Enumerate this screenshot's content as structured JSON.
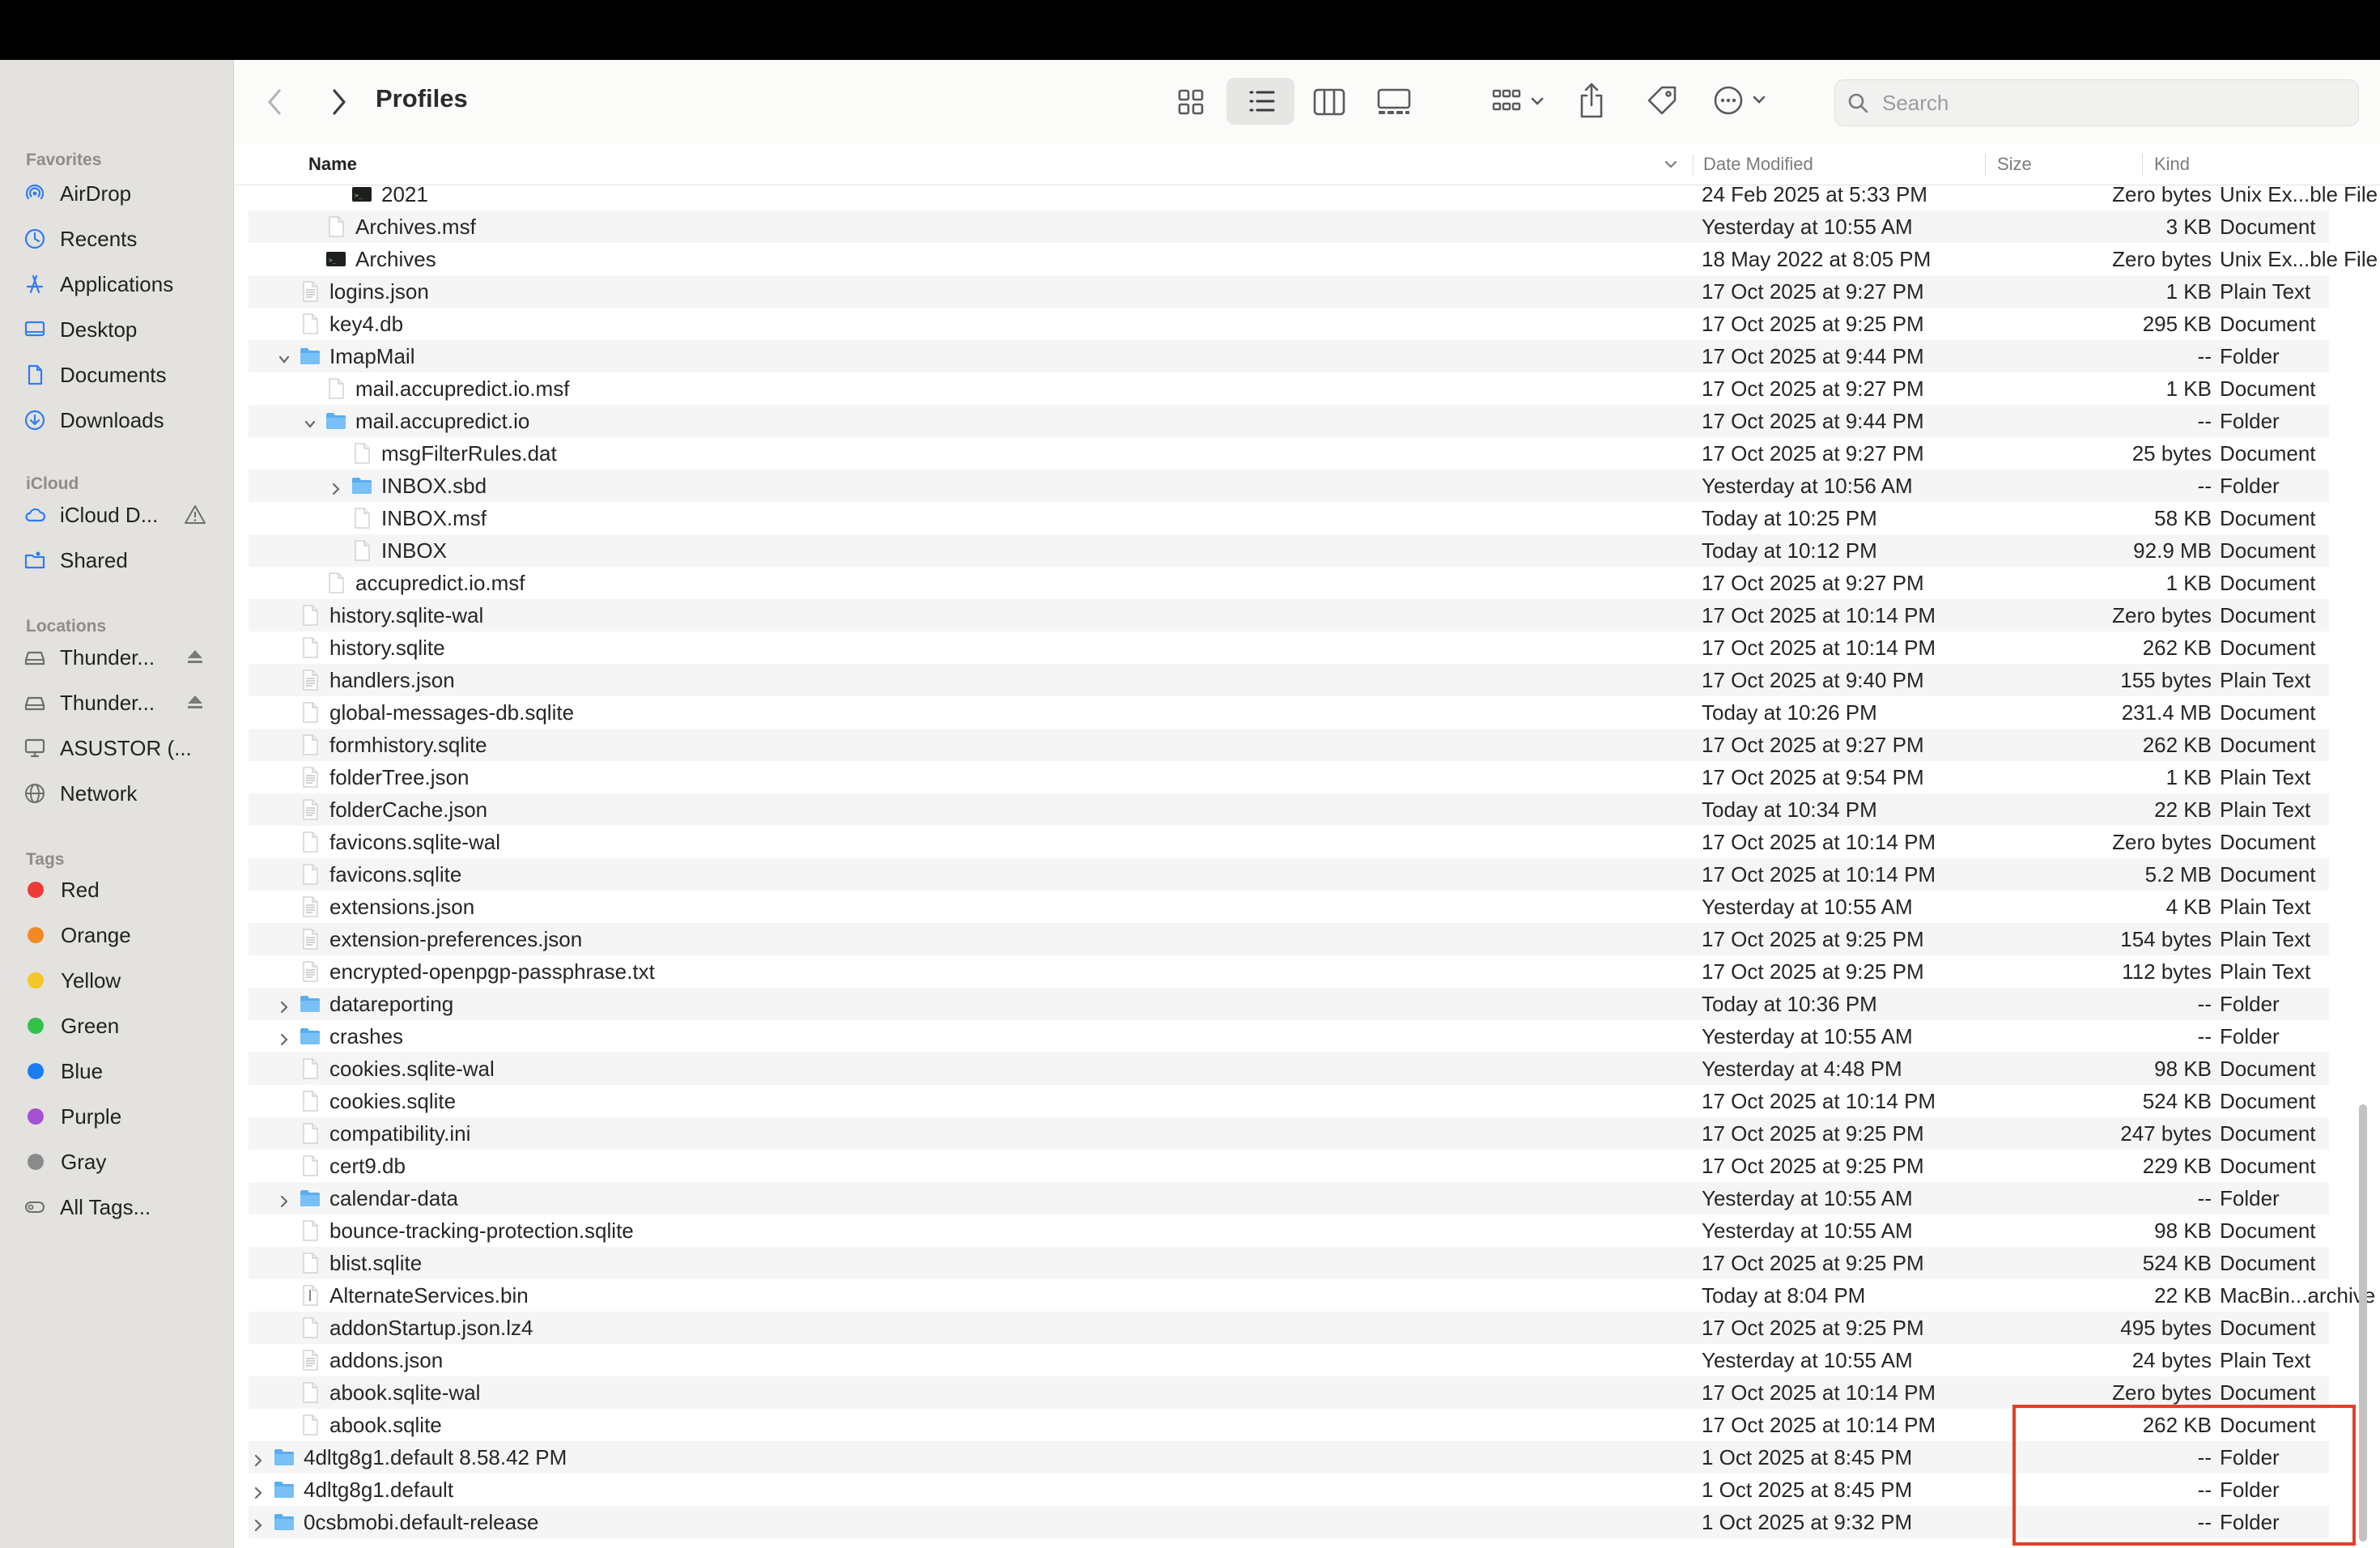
{
  "window": {
    "title": "Profiles"
  },
  "search": {
    "placeholder": "Search"
  },
  "sidebar": {
    "favorites_title": "Favorites",
    "favorites": [
      {
        "label": "AirDrop",
        "icon": "airdrop-icon"
      },
      {
        "label": "Recents",
        "icon": "clock-icon"
      },
      {
        "label": "Applications",
        "icon": "applications-icon"
      },
      {
        "label": "Desktop",
        "icon": "desktop-icon"
      },
      {
        "label": "Documents",
        "icon": "document-icon"
      },
      {
        "label": "Downloads",
        "icon": "download-icon"
      }
    ],
    "icloud_title": "iCloud",
    "icloud": [
      {
        "label": "iCloud D...",
        "icon": "cloud-icon"
      },
      {
        "label": "Shared",
        "icon": "shared-folder-icon"
      }
    ],
    "locations_title": "Locations",
    "locations": [
      {
        "label": "Thunder...",
        "icon": "drive-icon"
      },
      {
        "label": "Thunder...",
        "icon": "drive-icon"
      },
      {
        "label": "ASUSTOR (...",
        "icon": "display-icon"
      },
      {
        "label": "Network",
        "icon": "globe-icon"
      }
    ],
    "tags_title": "Tags",
    "tags": [
      {
        "label": "Red",
        "color": "#ee3b35"
      },
      {
        "label": "Orange",
        "color": "#f08a24"
      },
      {
        "label": "Yellow",
        "color": "#f5c628"
      },
      {
        "label": "Green",
        "color": "#34c14a"
      },
      {
        "label": "Blue",
        "color": "#1e7cf2"
      },
      {
        "label": "Purple",
        "color": "#a451d4"
      },
      {
        "label": "Gray",
        "color": "#8b8b8d"
      }
    ],
    "all_tags": "All Tags..."
  },
  "columns": {
    "name": "Name",
    "date": "Date Modified",
    "size": "Size",
    "kind": "Kind"
  },
  "files": [
    {
      "name": "2021",
      "date": "24 Feb 2025 at 5:33 PM",
      "size": "Zero bytes",
      "kind": "Unix Ex...ble File",
      "indent": 3,
      "type": "exec",
      "partial": true
    },
    {
      "name": "Archives.msf",
      "date": "Yesterday at 10:55 AM",
      "size": "3 KB",
      "kind": "Document",
      "indent": 2,
      "type": "doc"
    },
    {
      "name": "Archives",
      "date": "18 May 2022 at 8:05 PM",
      "size": "Zero bytes",
      "kind": "Unix Ex...ble File",
      "indent": 2,
      "type": "exec"
    },
    {
      "name": "logins.json",
      "date": "17 Oct 2025 at 9:27 PM",
      "size": "1 KB",
      "kind": "Plain Text",
      "indent": 1,
      "type": "text"
    },
    {
      "name": "key4.db",
      "date": "17 Oct 2025 at 9:25 PM",
      "size": "295 KB",
      "kind": "Document",
      "indent": 1,
      "type": "doc"
    },
    {
      "name": "ImapMail",
      "date": "17 Oct 2025 at 9:44 PM",
      "size": "--",
      "kind": "Folder",
      "indent": 1,
      "type": "folder",
      "disc": "open"
    },
    {
      "name": "mail.accupredict.io.msf",
      "date": "17 Oct 2025 at 9:27 PM",
      "size": "1 KB",
      "kind": "Document",
      "indent": 2,
      "type": "doc"
    },
    {
      "name": "mail.accupredict.io",
      "date": "17 Oct 2025 at 9:44 PM",
      "size": "--",
      "kind": "Folder",
      "indent": 2,
      "type": "folder",
      "disc": "open"
    },
    {
      "name": "msgFilterRules.dat",
      "date": "17 Oct 2025 at 9:27 PM",
      "size": "25 bytes",
      "kind": "Document",
      "indent": 3,
      "type": "doc"
    },
    {
      "name": "INBOX.sbd",
      "date": "Yesterday at 10:56 AM",
      "size": "--",
      "kind": "Folder",
      "indent": 3,
      "type": "folder",
      "disc": "closed"
    },
    {
      "name": "INBOX.msf",
      "date": "Today at 10:25 PM",
      "size": "58 KB",
      "kind": "Document",
      "indent": 3,
      "type": "doc"
    },
    {
      "name": "INBOX",
      "date": "Today at 10:12 PM",
      "size": "92.9 MB",
      "kind": "Document",
      "indent": 3,
      "type": "doc"
    },
    {
      "name": "accupredict.io.msf",
      "date": "17 Oct 2025 at 9:27 PM",
      "size": "1 KB",
      "kind": "Document",
      "indent": 2,
      "type": "doc"
    },
    {
      "name": "history.sqlite-wal",
      "date": "17 Oct 2025 at 10:14 PM",
      "size": "Zero bytes",
      "kind": "Document",
      "indent": 1,
      "type": "doc"
    },
    {
      "name": "history.sqlite",
      "date": "17 Oct 2025 at 10:14 PM",
      "size": "262 KB",
      "kind": "Document",
      "indent": 1,
      "type": "doc"
    },
    {
      "name": "handlers.json",
      "date": "17 Oct 2025 at 9:40 PM",
      "size": "155 bytes",
      "kind": "Plain Text",
      "indent": 1,
      "type": "text"
    },
    {
      "name": "global-messages-db.sqlite",
      "date": "Today at 10:26 PM",
      "size": "231.4 MB",
      "kind": "Document",
      "indent": 1,
      "type": "doc"
    },
    {
      "name": "formhistory.sqlite",
      "date": "17 Oct 2025 at 9:27 PM",
      "size": "262 KB",
      "kind": "Document",
      "indent": 1,
      "type": "doc"
    },
    {
      "name": "folderTree.json",
      "date": "17 Oct 2025 at 9:54 PM",
      "size": "1 KB",
      "kind": "Plain Text",
      "indent": 1,
      "type": "text"
    },
    {
      "name": "folderCache.json",
      "date": "Today at 10:34 PM",
      "size": "22 KB",
      "kind": "Plain Text",
      "indent": 1,
      "type": "text"
    },
    {
      "name": "favicons.sqlite-wal",
      "date": "17 Oct 2025 at 10:14 PM",
      "size": "Zero bytes",
      "kind": "Document",
      "indent": 1,
      "type": "doc"
    },
    {
      "name": "favicons.sqlite",
      "date": "17 Oct 2025 at 10:14 PM",
      "size": "5.2 MB",
      "kind": "Document",
      "indent": 1,
      "type": "doc"
    },
    {
      "name": "extensions.json",
      "date": "Yesterday at 10:55 AM",
      "size": "4 KB",
      "kind": "Plain Text",
      "indent": 1,
      "type": "text"
    },
    {
      "name": "extension-preferences.json",
      "date": "17 Oct 2025 at 9:25 PM",
      "size": "154 bytes",
      "kind": "Plain Text",
      "indent": 1,
      "type": "text"
    },
    {
      "name": "encrypted-openpgp-passphrase.txt",
      "date": "17 Oct 2025 at 9:25 PM",
      "size": "112 bytes",
      "kind": "Plain Text",
      "indent": 1,
      "type": "text"
    },
    {
      "name": "datareporting",
      "date": "Today at 10:36 PM",
      "size": "--",
      "kind": "Folder",
      "indent": 1,
      "type": "folder",
      "disc": "closed"
    },
    {
      "name": "crashes",
      "date": "Yesterday at 10:55 AM",
      "size": "--",
      "kind": "Folder",
      "indent": 1,
      "type": "folder",
      "disc": "closed"
    },
    {
      "name": "cookies.sqlite-wal",
      "date": "Yesterday at 4:48 PM",
      "size": "98 KB",
      "kind": "Document",
      "indent": 1,
      "type": "doc"
    },
    {
      "name": "cookies.sqlite",
      "date": "17 Oct 2025 at 10:14 PM",
      "size": "524 KB",
      "kind": "Document",
      "indent": 1,
      "type": "doc"
    },
    {
      "name": "compatibility.ini",
      "date": "17 Oct 2025 at 9:25 PM",
      "size": "247 bytes",
      "kind": "Document",
      "indent": 1,
      "type": "doc"
    },
    {
      "name": "cert9.db",
      "date": "17 Oct 2025 at 9:25 PM",
      "size": "229 KB",
      "kind": "Document",
      "indent": 1,
      "type": "doc"
    },
    {
      "name": "calendar-data",
      "date": "Yesterday at 10:55 AM",
      "size": "--",
      "kind": "Folder",
      "indent": 1,
      "type": "folder",
      "disc": "closed"
    },
    {
      "name": "bounce-tracking-protection.sqlite",
      "date": "Yesterday at 10:55 AM",
      "size": "98 KB",
      "kind": "Document",
      "indent": 1,
      "type": "doc"
    },
    {
      "name": "blist.sqlite",
      "date": "17 Oct 2025 at 9:25 PM",
      "size": "524 KB",
      "kind": "Document",
      "indent": 1,
      "type": "doc"
    },
    {
      "name": "AlternateServices.bin",
      "date": "Today at 8:04 PM",
      "size": "22 KB",
      "kind": "MacBin...archive",
      "indent": 1,
      "type": "bin"
    },
    {
      "name": "addonStartup.json.lz4",
      "date": "17 Oct 2025 at 9:25 PM",
      "size": "495 bytes",
      "kind": "Document",
      "indent": 1,
      "type": "doc"
    },
    {
      "name": "addons.json",
      "date": "Yesterday at 10:55 AM",
      "size": "24 bytes",
      "kind": "Plain Text",
      "indent": 1,
      "type": "text"
    },
    {
      "name": "abook.sqlite-wal",
      "date": "17 Oct 2025 at 10:14 PM",
      "size": "Zero bytes",
      "kind": "Document",
      "indent": 1,
      "type": "doc"
    },
    {
      "name": "abook.sqlite",
      "date": "17 Oct 2025 at 10:14 PM",
      "size": "262 KB",
      "kind": "Document",
      "indent": 1,
      "type": "doc"
    },
    {
      "name": "4dltg8g1.default 8.58.42 PM",
      "date": "1 Oct 2025 at 8:45 PM",
      "size": "--",
      "kind": "Folder",
      "indent": 0,
      "type": "folder",
      "disc": "closed"
    },
    {
      "name": "4dltg8g1.default",
      "date": "1 Oct 2025 at 8:45 PM",
      "size": "--",
      "kind": "Folder",
      "indent": 0,
      "type": "folder",
      "disc": "closed"
    },
    {
      "name": "0csbmobi.default-release",
      "date": "1 Oct 2025 at 9:32 PM",
      "size": "--",
      "kind": "Folder",
      "indent": 0,
      "type": "folder",
      "disc": "closed"
    }
  ]
}
